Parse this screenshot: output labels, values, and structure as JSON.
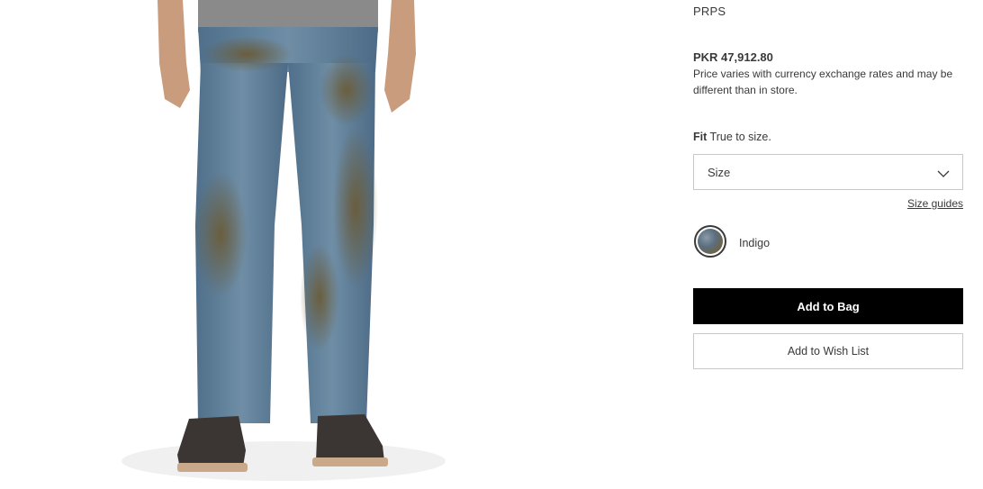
{
  "product": {
    "brand": "PRPS",
    "price": "PKR 47,912.80",
    "price_note": "Price varies with currency exchange rates and may be different than in store.",
    "fit_label": "Fit",
    "fit_value": "True to size.",
    "size_placeholder": "Size",
    "size_guides_label": "Size guides",
    "color_name": "Indigo",
    "add_to_bag_label": "Add to Bag",
    "add_to_wishlist_label": "Add to Wish List"
  },
  "colors": {
    "text": "#393939",
    "button_primary_bg": "#000000",
    "button_primary_text": "#ffffff",
    "border": "#c8c8c8"
  },
  "icons": {
    "select_arrow": "chevron-down-icon"
  }
}
